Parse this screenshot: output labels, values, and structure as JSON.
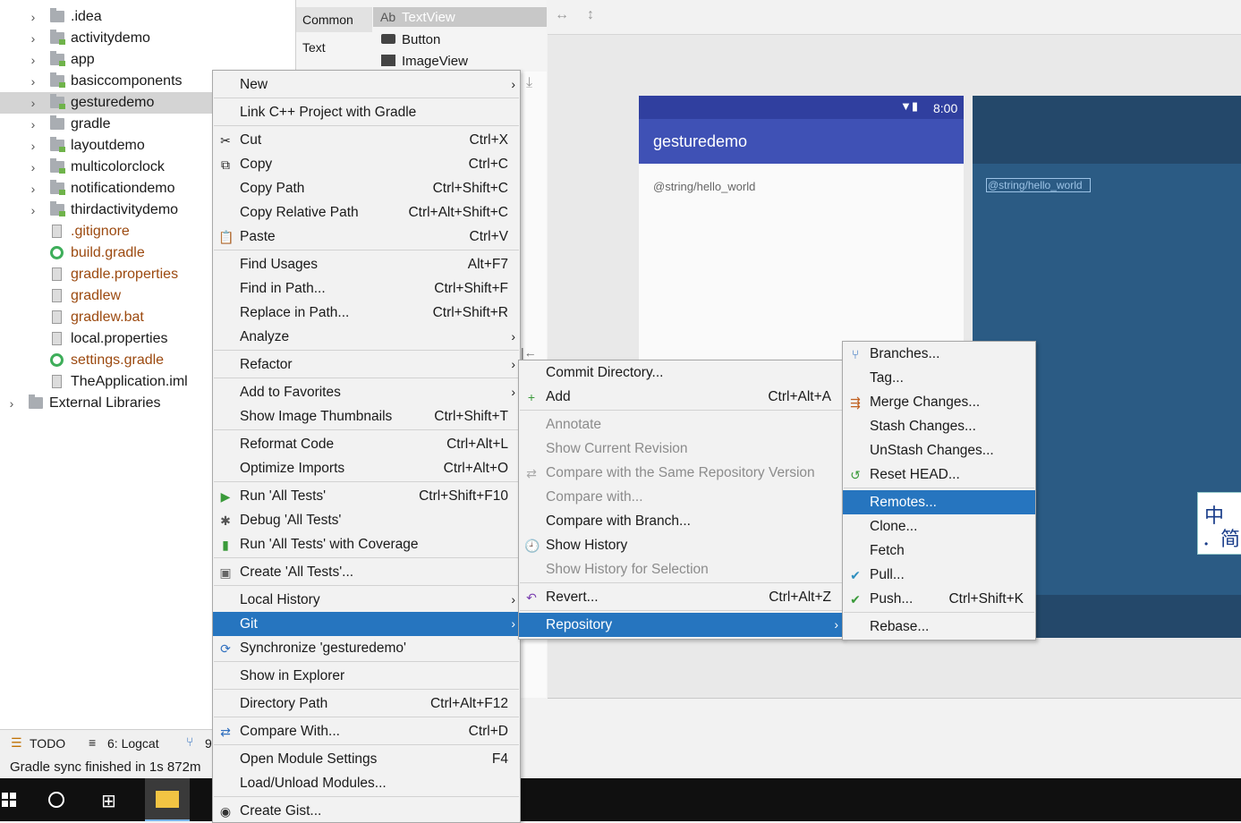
{
  "project_tree": {
    "items": [
      {
        "label": ".idea",
        "type": "folder",
        "arrow": "›"
      },
      {
        "label": "activitydemo",
        "type": "module",
        "arrow": "›"
      },
      {
        "label": "app",
        "type": "module",
        "arrow": "›"
      },
      {
        "label": "basiccomponents",
        "type": "module",
        "arrow": "›"
      },
      {
        "label": "gesturedemo",
        "type": "module",
        "arrow": "›"
      },
      {
        "label": "gradle",
        "type": "folder",
        "arrow": "›"
      },
      {
        "label": "layoutdemo",
        "type": "module",
        "arrow": "›"
      },
      {
        "label": "multicolorclock",
        "type": "module",
        "arrow": "›"
      },
      {
        "label": "notificationdemo",
        "type": "module",
        "arrow": "›"
      },
      {
        "label": "thirdactivitydemo",
        "type": "module",
        "arrow": "›"
      },
      {
        "label": ".gitignore",
        "type": "file"
      },
      {
        "label": "build.gradle",
        "type": "gradle"
      },
      {
        "label": "gradle.properties",
        "type": "file"
      },
      {
        "label": "gradlew",
        "type": "file"
      },
      {
        "label": "gradlew.bat",
        "type": "file"
      },
      {
        "label": "local.properties",
        "type": "file"
      },
      {
        "label": "settings.gradle",
        "type": "gradle"
      },
      {
        "label": "TheApplication.iml",
        "type": "file"
      },
      {
        "label": "External Libraries",
        "type": "libs",
        "arrow": "›"
      }
    ]
  },
  "palette": {
    "groups": [
      "Common",
      "Text"
    ],
    "widgets": [
      "TextView",
      "Button",
      "ImageView"
    ],
    "textview_prefix": "Ab"
  },
  "designer": {
    "time": "8:00",
    "app_title": "gesturedemo",
    "hello_text": "@string/hello_world",
    "blueprint_text": "@string/hello_world"
  },
  "bottom": {
    "tabs": [
      "TODO",
      "6: Logcat",
      "9"
    ],
    "status": "Gradle sync finished in 1s 872m"
  },
  "ime": {
    "line1": "中",
    "line2": "简"
  },
  "context_menu": {
    "items": [
      {
        "label": "New",
        "submenu": true
      },
      {
        "sep": true
      },
      {
        "label": "Link C++ Project with Gradle"
      },
      {
        "sep": true
      },
      {
        "label": "Cut",
        "shortcut": "Ctrl+X",
        "icon": "scissors-icon",
        "glyph": "✂"
      },
      {
        "label": "Copy",
        "shortcut": "Ctrl+C",
        "icon": "copy-icon",
        "glyph": "⧉"
      },
      {
        "label": "Copy Path",
        "shortcut": "Ctrl+Shift+C"
      },
      {
        "label": "Copy Relative Path",
        "shortcut": "Ctrl+Alt+Shift+C"
      },
      {
        "label": "Paste",
        "shortcut": "Ctrl+V",
        "icon": "paste-icon",
        "glyph": "📋"
      },
      {
        "sep": true
      },
      {
        "label": "Find Usages",
        "shortcut": "Alt+F7"
      },
      {
        "label": "Find in Path...",
        "shortcut": "Ctrl+Shift+F"
      },
      {
        "label": "Replace in Path...",
        "shortcut": "Ctrl+Shift+R"
      },
      {
        "label": "Analyze",
        "submenu": true
      },
      {
        "sep": true
      },
      {
        "label": "Refactor",
        "submenu": true
      },
      {
        "sep": true
      },
      {
        "label": "Add to Favorites",
        "submenu": true
      },
      {
        "label": "Show Image Thumbnails",
        "shortcut": "Ctrl+Shift+T"
      },
      {
        "sep": true
      },
      {
        "label": "Reformat Code",
        "shortcut": "Ctrl+Alt+L"
      },
      {
        "label": "Optimize Imports",
        "shortcut": "Ctrl+Alt+O"
      },
      {
        "sep": true
      },
      {
        "label": "Run 'All Tests'",
        "shortcut": "Ctrl+Shift+F10",
        "icon": "run-icon",
        "glyph": "▶",
        "color": "#3a9a3a"
      },
      {
        "label": "Debug 'All Tests'",
        "icon": "debug-icon",
        "glyph": "✱",
        "color": "#555"
      },
      {
        "label": "Run 'All Tests' with Coverage",
        "icon": "coverage-icon",
        "glyph": "▮",
        "color": "#3a9a3a"
      },
      {
        "sep": true
      },
      {
        "label": "Create 'All Tests'...",
        "icon": "create-test-icon",
        "glyph": "▣",
        "color": "#666"
      },
      {
        "sep": true
      },
      {
        "label": "Local History",
        "submenu": true
      },
      {
        "label": "Git",
        "submenu": true,
        "highlight": true
      },
      {
        "label": "Synchronize 'gesturedemo'",
        "icon": "sync-icon",
        "glyph": "⟳",
        "color": "#2f6fbf"
      },
      {
        "sep": true
      },
      {
        "label": "Show in Explorer"
      },
      {
        "sep": true
      },
      {
        "label": "Directory Path",
        "shortcut": "Ctrl+Alt+F12"
      },
      {
        "sep": true
      },
      {
        "label": "Compare With...",
        "shortcut": "Ctrl+D",
        "icon": "compare-icon",
        "glyph": "⇄",
        "color": "#2f6fbf"
      },
      {
        "sep": true
      },
      {
        "label": "Open Module Settings",
        "shortcut": "F4"
      },
      {
        "label": "Load/Unload Modules..."
      },
      {
        "sep": true
      },
      {
        "label": "Create Gist...",
        "icon": "github-icon",
        "glyph": "◉",
        "color": "#333"
      }
    ]
  },
  "git_menu": {
    "items": [
      {
        "label": "Commit Directory..."
      },
      {
        "label": "Add",
        "shortcut": "Ctrl+Alt+A",
        "icon": "add-icon",
        "glyph": "+",
        "color": "#3a9a3a"
      },
      {
        "sep": true
      },
      {
        "label": "Annotate",
        "disabled": true
      },
      {
        "label": "Show Current Revision",
        "disabled": true
      },
      {
        "label": "Compare with the Same Repository Version",
        "disabled": true,
        "icon": "compare-icon",
        "glyph": "⇄",
        "color": "#aaa"
      },
      {
        "label": "Compare with...",
        "disabled": true
      },
      {
        "label": "Compare with Branch..."
      },
      {
        "label": "Show History",
        "icon": "history-icon",
        "glyph": "🕘",
        "color": "#2f6fbf"
      },
      {
        "label": "Show History for Selection",
        "disabled": true
      },
      {
        "sep": true
      },
      {
        "label": "Revert...",
        "shortcut": "Ctrl+Alt+Z",
        "icon": "revert-icon",
        "glyph": "↶",
        "color": "#7a3fb0"
      },
      {
        "sep": true
      },
      {
        "label": "Repository",
        "submenu": true,
        "highlight": true
      }
    ]
  },
  "repo_menu": {
    "items": [
      {
        "label": "Branches...",
        "icon": "branch-icon",
        "glyph": "⑂",
        "color": "#2f6fbf"
      },
      {
        "label": "Tag..."
      },
      {
        "label": "Merge Changes...",
        "icon": "merge-icon",
        "glyph": "⇶",
        "color": "#c06020"
      },
      {
        "label": "Stash Changes..."
      },
      {
        "label": "UnStash Changes..."
      },
      {
        "label": "Reset HEAD...",
        "icon": "reset-icon",
        "glyph": "↺",
        "color": "#3a9a3a"
      },
      {
        "sep": true
      },
      {
        "label": "Remotes...",
        "highlight": true
      },
      {
        "label": "Clone..."
      },
      {
        "label": "Fetch"
      },
      {
        "label": "Pull...",
        "icon": "pull-icon",
        "glyph": "✔",
        "color": "#2f8fbf"
      },
      {
        "label": "Push...",
        "shortcut": "Ctrl+Shift+K",
        "icon": "push-icon",
        "glyph": "✔",
        "color": "#3a9a3a"
      },
      {
        "sep": true
      },
      {
        "label": "Rebase..."
      }
    ]
  }
}
